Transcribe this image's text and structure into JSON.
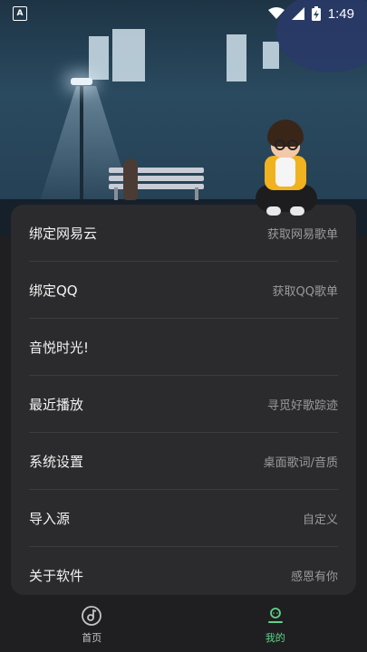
{
  "status_bar": {
    "time": "1:49",
    "left_icon": "a-notification-icon",
    "right_icons": [
      "wifi-icon",
      "signal-icon",
      "battery-charging-icon"
    ]
  },
  "menu": {
    "items": [
      {
        "label": "绑定网易云",
        "sub": "获取网易歌单"
      },
      {
        "label": "绑定QQ",
        "sub": "获取QQ歌单"
      },
      {
        "label": "音悦时光!",
        "sub": ""
      },
      {
        "label": "最近播放",
        "sub": "寻觅好歌踪迹"
      },
      {
        "label": "系统设置",
        "sub": "桌面歌词/音质"
      },
      {
        "label": "导入源",
        "sub": "自定义"
      },
      {
        "label": "关于软件",
        "sub": "感恩有你"
      }
    ]
  },
  "bottom_nav": {
    "home_label": "首页",
    "mine_label": "我的",
    "active_color": "#5fd38a"
  }
}
